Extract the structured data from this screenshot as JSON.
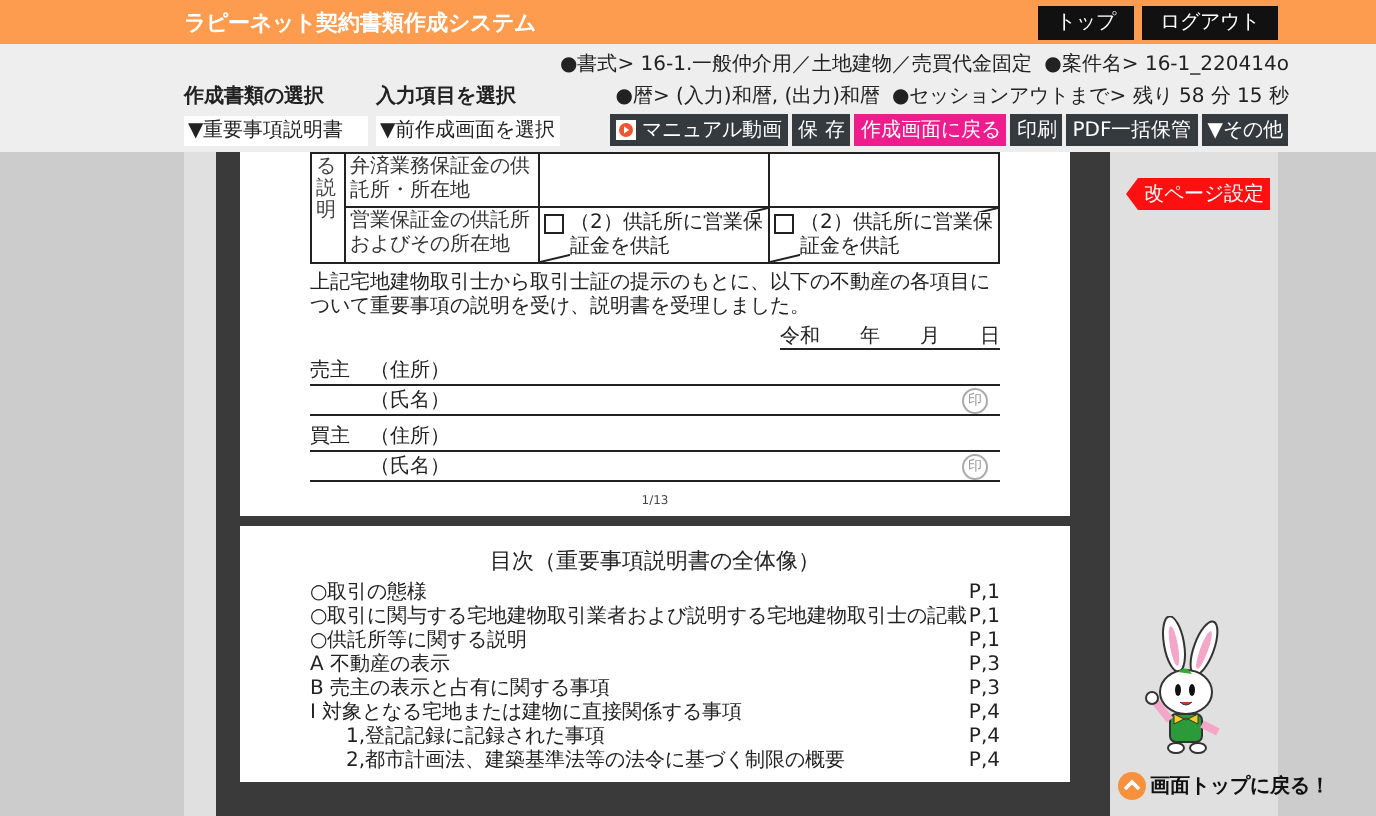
{
  "header": {
    "title": "ラピーネット契約書類作成システム",
    "buttons": [
      "トップ",
      "ログアウト"
    ]
  },
  "selectors": [
    {
      "label": "作成書類の選択",
      "value": "▼重要事項説明書"
    },
    {
      "label": "入力項目を選択",
      "value": "▼前作成画面を選択"
    }
  ],
  "info_lines": [
    [
      "●書式> 16-1.一般仲介用／土地建物／売買代金固定",
      "●案件名> 16-1_220414o"
    ],
    [
      "●暦> (入力)和暦, (出力)和暦",
      "●セッションアウトまで> 残り 58 分 15 秒"
    ]
  ],
  "toolbar": [
    {
      "label": "マニュアル動画",
      "kind": "video"
    },
    {
      "label": "保 存",
      "kind": "dark"
    },
    {
      "label": "作成画面に戻る",
      "kind": "accent"
    },
    {
      "label": "印刷",
      "kind": "dark"
    },
    {
      "label": "PDF一括保管",
      "kind": "dark"
    },
    {
      "label": "▼その他",
      "kind": "dark"
    }
  ],
  "page1": {
    "section_label": "る説明",
    "rows": [
      {
        "label": "弁済業務保証金の供託所・所在地"
      },
      {
        "label": "営業保証金の供託所およびその所在地",
        "options": [
          {
            "text": "（2）供託所に営業保証金を供託",
            "checked": false
          },
          {
            "text": "（2）供託所に営業保証金を供託",
            "checked": false
          }
        ]
      }
    ],
    "statement": "上記宅地建物取引士から取引士証の提示のもとに、以下の不動産の各項目について重要事項の説明を受け、説明書を受理しました。",
    "date": "令和　　年　　月　　日",
    "parties": [
      {
        "role": "売主",
        "address_label": "（住所）",
        "name_label": "（氏名）",
        "seal": "印"
      },
      {
        "role": "買主",
        "address_label": "（住所）",
        "name_label": "（氏名）",
        "seal": "印"
      }
    ],
    "page_number": "1/13"
  },
  "page2": {
    "title": "目次（重要事項説明書の全体像）",
    "entries": [
      {
        "text": "○取引の態様",
        "page": "P,1"
      },
      {
        "text": "○取引に関与する宅地建物取引業者および説明する宅地建物取引士の記載",
        "page": "P,1"
      },
      {
        "text": "○供託所等に関する説明",
        "page": "P,1"
      },
      {
        "text": "A 不動産の表示",
        "page": "P,3"
      },
      {
        "text": "B 売主の表示と占有に関する事項",
        "page": "P,3"
      },
      {
        "text": "Ⅰ 対象となる宅地または建物に直接関係する事項",
        "page": "P,4",
        "children": [
          {
            "text": "1,登記記録に記録された事項",
            "page": "P,4"
          },
          {
            "text": "2,都市計画法、建築基準法等の法令に基づく制限の概要",
            "page": "P,4"
          }
        ]
      }
    ]
  },
  "side": {
    "page_break_tag": "改ページ設定",
    "back_to_top": "画面トップに戻る！"
  }
}
